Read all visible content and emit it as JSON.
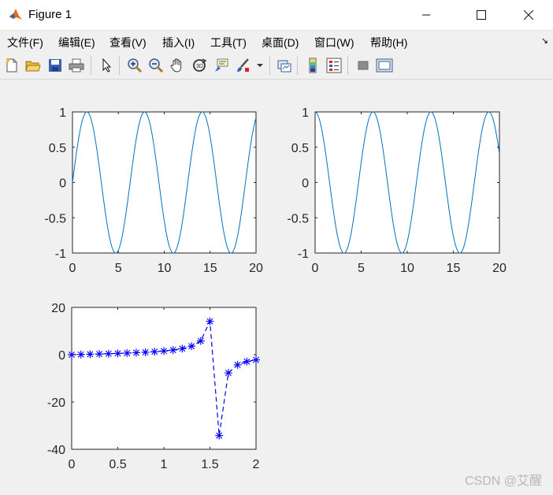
{
  "window": {
    "title": "Figure 1",
    "minimize_icon": "minimize-icon",
    "maximize_icon": "maximize-icon",
    "close_icon": "close-icon"
  },
  "menu": {
    "items": [
      "文件(F)",
      "编辑(E)",
      "查看(V)",
      "插入(I)",
      "工具(T)",
      "桌面(D)",
      "窗口(W)",
      "帮助(H)"
    ]
  },
  "toolbar": {
    "icons": [
      "new-figure-icon",
      "open-file-icon",
      "save-icon",
      "print-icon",
      "select-pointer-icon",
      "zoom-in-icon",
      "zoom-out-icon",
      "pan-hand-icon",
      "rotate-3d-icon",
      "data-cursor-icon",
      "brush-icon",
      "link-plot-icon",
      "colorbar-icon",
      "legend-icon",
      "hide-plot-tools-icon",
      "show-plot-tools-icon"
    ]
  },
  "chart_data": [
    {
      "type": "line",
      "subplot": "top-left",
      "function": "sin(x)",
      "x_range": [
        0,
        20
      ],
      "xlim": [
        0,
        20
      ],
      "ylim": [
        -1,
        1
      ],
      "xticks": [
        "0",
        "5",
        "10",
        "15",
        "20"
      ],
      "yticks": [
        "1",
        "0.5",
        "0",
        "-0.5",
        "-1"
      ],
      "color": "#0072bd"
    },
    {
      "type": "line",
      "subplot": "top-right",
      "function": "cos(x)",
      "x_range": [
        0,
        20
      ],
      "xlim": [
        0,
        20
      ],
      "ylim": [
        -1,
        1
      ],
      "xticks": [
        "0",
        "5",
        "10",
        "15",
        "20"
      ],
      "yticks": [
        "1",
        "0.5",
        "0",
        "-0.5",
        "-1"
      ],
      "color": "#0072bd"
    },
    {
      "type": "line",
      "subplot": "bottom-left",
      "function": "tan(x)",
      "marker": "*",
      "line_style": "dashed",
      "color": "#0000ff",
      "x": [
        0,
        0.1,
        0.2,
        0.3,
        0.4,
        0.5,
        0.6,
        0.7,
        0.8,
        0.9,
        1.0,
        1.1,
        1.2,
        1.3,
        1.4,
        1.5,
        1.6,
        1.7,
        1.8,
        1.9,
        2.0
      ],
      "y": [
        0,
        0.1,
        0.2,
        0.31,
        0.42,
        0.55,
        0.68,
        0.84,
        1.03,
        1.26,
        1.56,
        1.96,
        2.57,
        3.6,
        5.8,
        14.1,
        -34.2,
        -7.7,
        -4.3,
        -2.9,
        -2.2
      ],
      "xlim": [
        0,
        2
      ],
      "ylim": [
        -40,
        20
      ],
      "xticks": [
        "0",
        "0.5",
        "1",
        "1.5",
        "2"
      ],
      "yticks": [
        "20",
        "0",
        "-20",
        "-40"
      ]
    }
  ],
  "watermark": "CSDN @艾醒"
}
